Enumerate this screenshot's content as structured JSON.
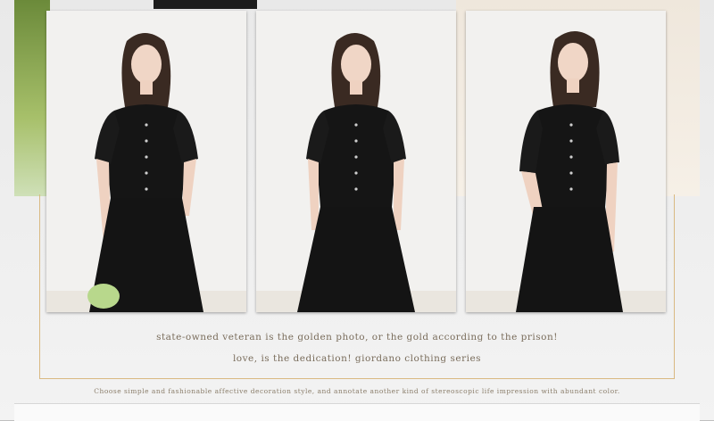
{
  "banner": {
    "caption_line_1": "state-owned veteran is the golden photo, or the gold according to the prison!",
    "caption_line_2": "love, is the dedication! giordano clothing series",
    "caption_line_3": "Choose simple and fashionable affective decoration style, and annotate another kind of stereoscopic life impression with abundant color."
  },
  "colors": {
    "dress": "#151515",
    "frame_gold": "#d9b982",
    "caption_text": "#7a6d5c"
  }
}
